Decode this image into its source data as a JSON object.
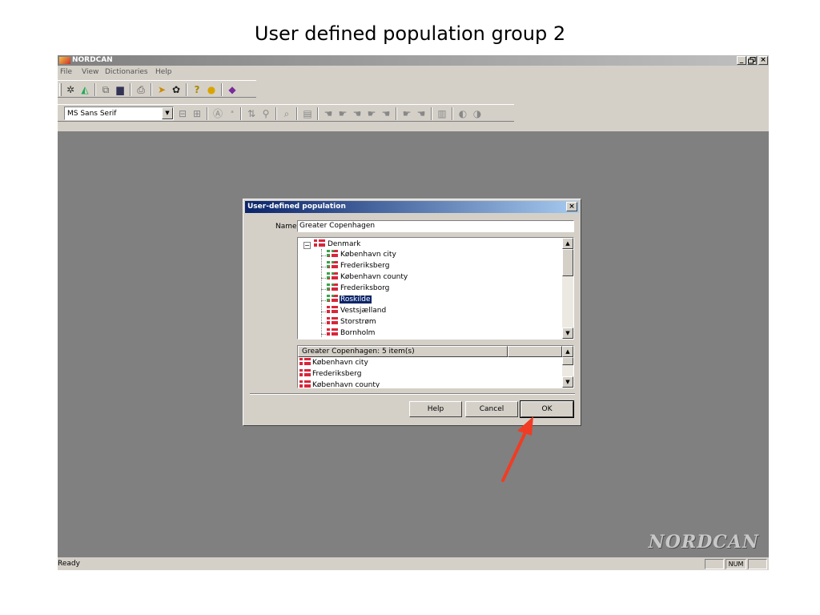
{
  "slide": {
    "title": "User defined population group 2"
  },
  "app": {
    "title": "NORDCAN",
    "window_buttons": {
      "minimize": "_",
      "maximize": "̅",
      "close": "×"
    },
    "menu": [
      "File",
      "View",
      "Dictionaries",
      "Help"
    ],
    "font_combo": {
      "value": "MS Sans Serif"
    },
    "watermark": "NORDCAN",
    "status": {
      "text": "Ready",
      "num": "NUM"
    }
  },
  "dialog": {
    "title": "User-defined population",
    "close_label": "×",
    "name_label": "Name",
    "name_value": "Greater Copenhagen",
    "tree": {
      "root": "Denmark",
      "expander": "−",
      "children": [
        {
          "label": "København city",
          "mixed": true
        },
        {
          "label": "Frederiksberg",
          "mixed": true
        },
        {
          "label": "København county",
          "mixed": true
        },
        {
          "label": "Frederiksborg",
          "mixed": true
        },
        {
          "label": "Roskilde",
          "mixed": true,
          "selected": true
        },
        {
          "label": "Vestsjælland",
          "mixed": false
        },
        {
          "label": "Storstrøm",
          "mixed": false
        },
        {
          "label": "Bornholm",
          "mixed": false
        }
      ]
    },
    "list": {
      "header": "Greater Copenhagen: 5 item(s)",
      "items": [
        "København city",
        "Frederiksberg",
        "København county"
      ]
    },
    "buttons": {
      "help": "Help",
      "cancel": "Cancel",
      "ok": "OK"
    }
  },
  "colors": {
    "annotation_arrow": "#f03c24",
    "selection": "#0a246a",
    "workspace": "#808080"
  }
}
